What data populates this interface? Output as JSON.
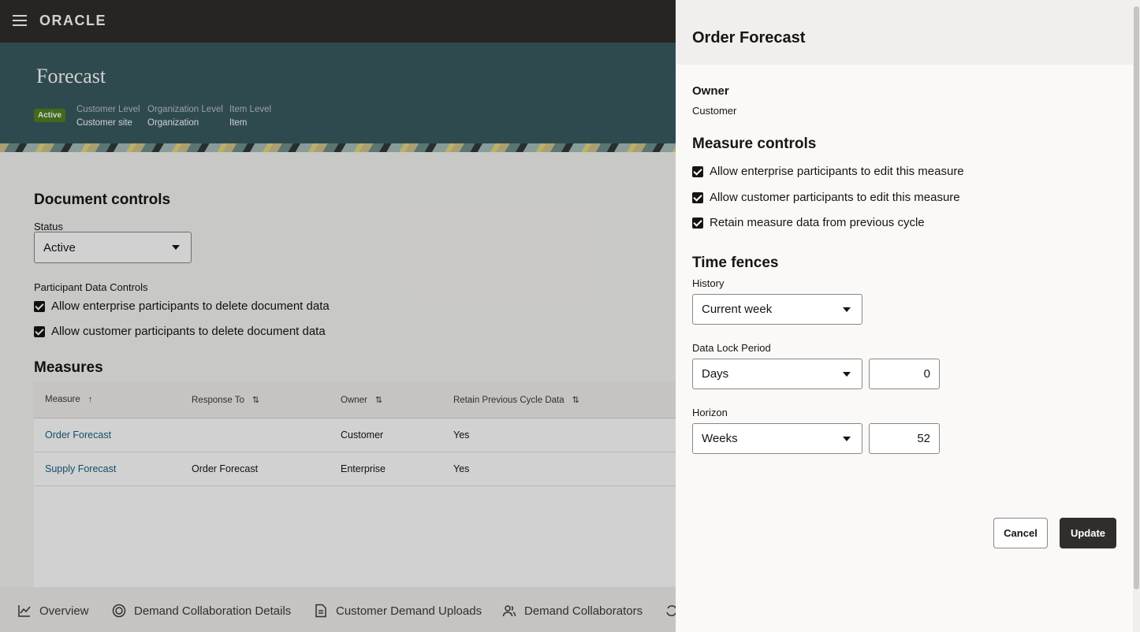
{
  "header": {
    "logo": "ORACLE"
  },
  "hero": {
    "title": "Forecast",
    "status_badge": "Active",
    "meta": [
      {
        "label": "Customer Level",
        "value": "Customer site"
      },
      {
        "label": "Organization Level",
        "value": "Organization"
      },
      {
        "label": "Item Level",
        "value": "Item"
      }
    ]
  },
  "document_controls": {
    "title": "Document controls",
    "status_label": "Status",
    "status_value": "Active",
    "participant_label": "Participant Data Controls",
    "checkboxes": [
      "Allow enterprise participants to delete document data",
      "Allow customer participants to delete document data"
    ]
  },
  "measures": {
    "title": "Measures",
    "columns": [
      "Measure",
      "Response To",
      "Owner",
      "Retain Previous Cycle Data"
    ],
    "rows": [
      {
        "measure": "Order Forecast",
        "response_to": "",
        "owner": "Customer",
        "retain": "Yes"
      },
      {
        "measure": "Supply Forecast",
        "response_to": "Order Forecast",
        "owner": "Enterprise",
        "retain": "Yes"
      }
    ]
  },
  "bottom_nav": [
    "Overview",
    "Demand Collaboration Details",
    "Customer Demand Uploads",
    "Demand Collaborators"
  ],
  "drawer": {
    "title": "Order Forecast",
    "owner_label": "Owner",
    "owner_value": "Customer",
    "measure_controls_title": "Measure controls",
    "measure_controls": [
      "Allow enterprise participants to edit this measure",
      "Allow customer participants to edit this measure",
      "Retain measure data from previous cycle"
    ],
    "time_fences_title": "Time fences",
    "history_label": "History",
    "history_value": "Current week",
    "data_lock_label": "Data Lock Period",
    "data_lock_unit": "Days",
    "data_lock_value": "0",
    "horizon_label": "Horizon",
    "horizon_unit": "Weeks",
    "horizon_value": "52",
    "cancel_label": "Cancel",
    "update_label": "Update"
  }
}
